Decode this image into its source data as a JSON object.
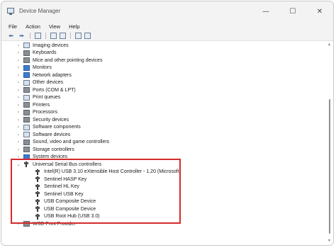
{
  "window": {
    "title": "Device Manager",
    "minimize_glyph": "—",
    "maximize_glyph": "☐",
    "close_glyph": "✕"
  },
  "menu": {
    "items": [
      "File",
      "Action",
      "View",
      "Help"
    ]
  },
  "toolbar": {
    "back_glyph": "⬅",
    "forward_glyph": "➡"
  },
  "tree": {
    "collapsed_glyph": "›",
    "expanded_glyph": "⌄",
    "categories": [
      {
        "label": "Imaging devices",
        "icon": "camera-icon"
      },
      {
        "label": "Keyboards",
        "icon": "keyboard-icon"
      },
      {
        "label": "Mice and other pointing devices",
        "icon": "mouse-icon"
      },
      {
        "label": "Monitors",
        "icon": "monitor-icon"
      },
      {
        "label": "Network adapters",
        "icon": "network-icon"
      },
      {
        "label": "Other devices",
        "icon": "other-devices-icon"
      },
      {
        "label": "Ports (COM & LPT)",
        "icon": "port-icon"
      },
      {
        "label": "Print queues",
        "icon": "print-queue-icon"
      },
      {
        "label": "Printers",
        "icon": "printer-icon"
      },
      {
        "label": "Processors",
        "icon": "processor-icon"
      },
      {
        "label": "Security devices",
        "icon": "security-icon"
      },
      {
        "label": "Software components",
        "icon": "software-component-icon"
      },
      {
        "label": "Software devices",
        "icon": "software-device-icon"
      },
      {
        "label": "Sound, video and game controllers",
        "icon": "sound-icon"
      },
      {
        "label": "Storage controllers",
        "icon": "storage-icon"
      },
      {
        "label": "System devices",
        "icon": "system-icon"
      }
    ],
    "usb": {
      "label": "Universal Serial Bus controllers",
      "children": [
        "Intel(R) USB 3.10 eXtensible Host Controller - 1.20 (Microsoft)",
        "Sentinel HASP Key",
        "Sentinel HL Key",
        "Sentinel USB Key",
        "USB Composite Device",
        "USB Composite Device",
        "USB Root Hub (USB 3.0)"
      ]
    },
    "after_usb": {
      "label": "WSD Print Provider",
      "icon": "printer-icon"
    }
  },
  "colors": {
    "highlight_border": "#d42a2a"
  }
}
